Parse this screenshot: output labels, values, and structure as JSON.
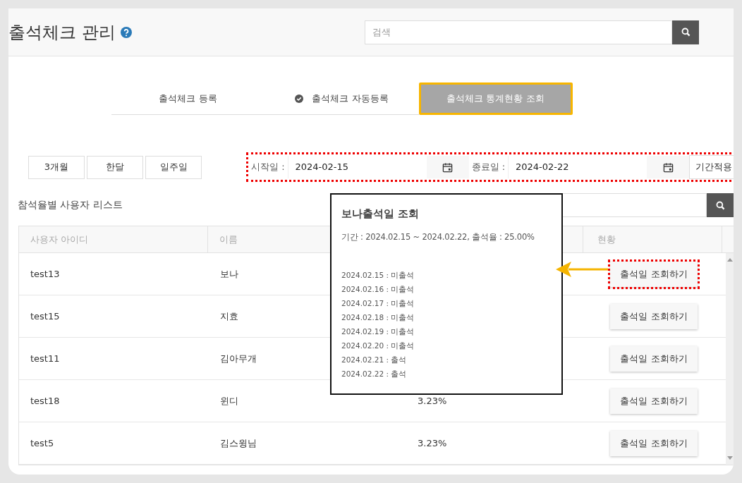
{
  "header": {
    "title": "출석체크 관리",
    "search": {
      "placeholder": "검색"
    }
  },
  "tabs": [
    {
      "label": "출석체크 등록",
      "checked": false,
      "selected": false
    },
    {
      "label": "출석체크 자동등록",
      "checked": true,
      "selected": false
    },
    {
      "label": "출석체크 통계현황 조회",
      "checked": false,
      "selected": true
    }
  ],
  "period_buttons": [
    "3개월",
    "한달",
    "일주일"
  ],
  "date_range": {
    "highlighted": true,
    "start_label": "시작일 :",
    "start": "2024-02-15",
    "end_label": "종료일 :",
    "end": "2024-02-22",
    "apply": "기간적용"
  },
  "list": {
    "title": "참석율별 사용자 리스트",
    "columns": [
      "사용자 아이디",
      "이름",
      "현황"
    ],
    "rows": [
      {
        "user_id": "test13",
        "name": "보나",
        "button": "출석일 조회하기",
        "highlighted": true
      },
      {
        "user_id": "test15",
        "name": "지효",
        "button": "출석일 조회하기",
        "highlighted": false
      },
      {
        "user_id": "test11",
        "name": "김아무개",
        "button": "출석일 조회하기",
        "highlighted": false
      },
      {
        "user_id": "test18",
        "name": "윈디",
        "rate": "3.23%",
        "button": "출석일 조회하기",
        "highlighted": false
      },
      {
        "user_id": "test5",
        "name": "김스윙님",
        "rate": "3.23%",
        "button": "출석일 조회하기",
        "highlighted": false
      }
    ]
  },
  "popup": {
    "title": "보나출석일 조회",
    "summary": "기간 : 2024.02.15 ~ 2024.02.22, 출석율 : 25.00%",
    "entries": [
      "2024.02.15 : 미출석",
      "2024.02.16 : 미출석",
      "2024.02.17 : 미출석",
      "2024.02.18 : 미출석",
      "2024.02.19 : 미출석",
      "2024.02.20 : 미출석",
      "2024.02.21 : 출석",
      "2024.02.22 : 출석"
    ]
  }
}
